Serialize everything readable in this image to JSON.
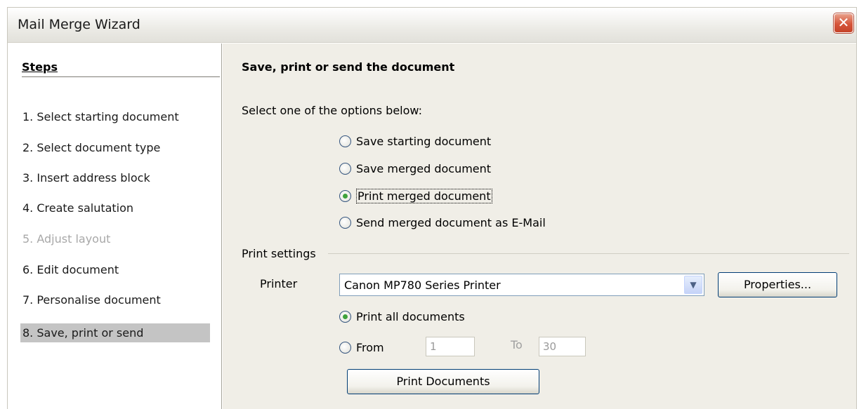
{
  "window": {
    "title": "Mail Merge Wizard",
    "close_glyph": "✕"
  },
  "sidebar": {
    "header": "Steps",
    "steps": [
      {
        "label": "1.  Select starting document",
        "state": "normal"
      },
      {
        "label": "2.  Select document type",
        "state": "normal"
      },
      {
        "label": "3.  Insert address block",
        "state": "normal"
      },
      {
        "label": "4.  Create salutation",
        "state": "normal"
      },
      {
        "label": "5.  Adjust layout",
        "state": "disabled"
      },
      {
        "label": "6.  Edit document",
        "state": "normal"
      },
      {
        "label": "7.  Personalise document",
        "state": "normal"
      },
      {
        "label": "8.  Save, print or send",
        "state": "active"
      }
    ]
  },
  "main": {
    "heading": "Save, print or send the document",
    "instruction": "Select one of the options below:",
    "options": [
      {
        "label": "Save starting document",
        "checked": false
      },
      {
        "label": "Save merged document",
        "checked": false
      },
      {
        "label": "Print merged document",
        "checked": true
      },
      {
        "label": "Send merged document as E-Mail",
        "checked": false
      }
    ],
    "print_settings": {
      "group_label": "Print settings",
      "printer_label": "Printer",
      "printer_value": "Canon MP780 Series Printer",
      "properties_button": "Properties...",
      "print_all_label": "Print all documents",
      "print_all_checked": true,
      "from_label": "From",
      "from_checked": false,
      "from_value": "1",
      "to_label": "To",
      "to_value": "30",
      "print_button": "Print Documents"
    }
  },
  "colors": {
    "content_bg": "#f0eee7",
    "active_step_bg": "#c4c4c4",
    "disabled_text": "#a8a8a8",
    "radio_checked": "#3fa23c"
  },
  "icons": {
    "close": "close-icon",
    "dropdown": "chevron-down-icon"
  }
}
